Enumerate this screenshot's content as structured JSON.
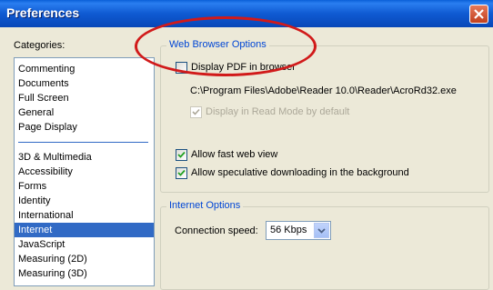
{
  "window": {
    "title": "Preferences"
  },
  "categories": {
    "label": "Categories:",
    "group1": [
      "Commenting",
      "Documents",
      "Full Screen",
      "General",
      "Page Display"
    ],
    "group2": [
      "3D & Multimedia",
      "Accessibility",
      "Forms",
      "Identity",
      "International",
      "Internet",
      "JavaScript",
      "Measuring (2D)",
      "Measuring (3D)"
    ],
    "selected": "Internet"
  },
  "web_browser_options": {
    "title": "Web Browser Options",
    "display_pdf": {
      "label": "Display PDF in browser",
      "checked": false
    },
    "reader_path": "C:\\Program Files\\Adobe\\Reader 10.0\\Reader\\AcroRd32.exe",
    "read_mode": {
      "label": "Display in Read Mode by default",
      "checked": true,
      "disabled": true
    },
    "fast_web_view": {
      "label": "Allow fast web view",
      "checked": true
    },
    "speculative_download": {
      "label": "Allow speculative downloading in the background",
      "checked": true
    }
  },
  "internet_options": {
    "title": "Internet Options",
    "connection_speed_label": "Connection speed:",
    "connection_speed_value": "56 Kbps"
  },
  "colors": {
    "annotation": "#d11a1a",
    "selection": "#316ac5",
    "group_title": "#0046d5"
  }
}
